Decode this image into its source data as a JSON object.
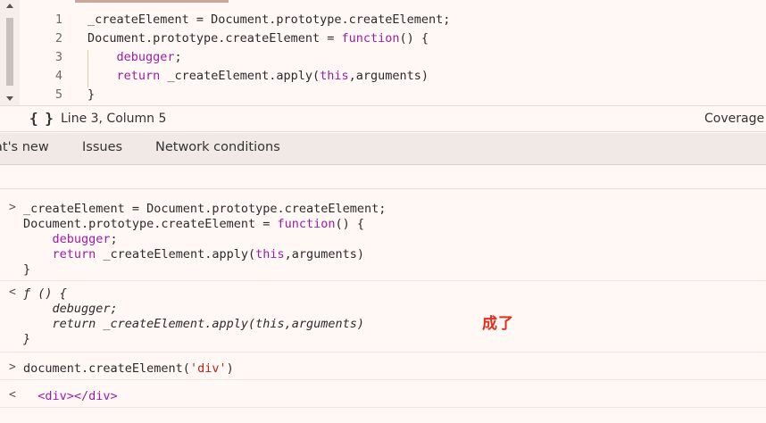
{
  "editor": {
    "lines": [
      {
        "num": "1",
        "parts": [
          {
            "t": "_createElement = Document.prototype.createElement;",
            "c": ""
          }
        ]
      },
      {
        "num": "2",
        "parts": [
          {
            "t": "Document.prototype.createElement = ",
            "c": ""
          },
          {
            "t": "function",
            "c": "kw"
          },
          {
            "t": "() {",
            "c": ""
          }
        ]
      },
      {
        "num": "3",
        "parts": [
          {
            "t": "    ",
            "c": ""
          },
          {
            "t": "debugger",
            "c": "kw"
          },
          {
            "t": ";",
            "c": ""
          }
        ]
      },
      {
        "num": "4",
        "parts": [
          {
            "t": "    ",
            "c": ""
          },
          {
            "t": "return",
            "c": "kw"
          },
          {
            "t": " _createElement.apply(",
            "c": ""
          },
          {
            "t": "this",
            "c": "kw"
          },
          {
            "t": ",arguments)",
            "c": ""
          }
        ]
      },
      {
        "num": "5",
        "parts": [
          {
            "t": "}",
            "c": ""
          }
        ]
      }
    ]
  },
  "status": {
    "braces_icon": "{ }",
    "cursor_position": "Line 3, Column 5",
    "coverage": "Coverage"
  },
  "drawer": {
    "tabs": [
      "at's new",
      "Issues",
      "Network conditions"
    ]
  },
  "console": {
    "input_prompt": ">",
    "output_prompt": "<",
    "entries": [
      {
        "type": "input",
        "lines": [
          [
            {
              "t": "_createElement = Document.prototype.createElement;",
              "c": ""
            }
          ],
          [
            {
              "t": "Document.prototype.createElement = ",
              "c": ""
            },
            {
              "t": "function",
              "c": "kw"
            },
            {
              "t": "() {",
              "c": ""
            }
          ],
          [
            {
              "t": "    ",
              "c": ""
            },
            {
              "t": "debugger",
              "c": "kw"
            },
            {
              "t": ";",
              "c": ""
            }
          ],
          [
            {
              "t": "    ",
              "c": ""
            },
            {
              "t": "return",
              "c": "kw"
            },
            {
              "t": " _createElement.apply(",
              "c": ""
            },
            {
              "t": "this",
              "c": "kw"
            },
            {
              "t": ",arguments)",
              "c": ""
            }
          ],
          [
            {
              "t": "}",
              "c": ""
            }
          ]
        ]
      },
      {
        "type": "output",
        "lines": [
          [
            {
              "t": "ƒ () {",
              "c": "it"
            }
          ],
          [
            {
              "t": "    debugger;",
              "c": "it"
            }
          ],
          [
            {
              "t": "    return _createElement.apply(this,arguments)",
              "c": "it"
            }
          ],
          [
            {
              "t": "}",
              "c": "it"
            }
          ]
        ]
      },
      {
        "type": "input",
        "lines": [
          [
            {
              "t": "document.createElement(",
              "c": ""
            },
            {
              "t": "'div'",
              "c": "str"
            },
            {
              "t": ")",
              "c": ""
            }
          ]
        ]
      },
      {
        "type": "output",
        "lines": [
          [
            {
              "t": "  ",
              "c": ""
            },
            {
              "t": "<div></div>",
              "c": "tag"
            }
          ]
        ]
      }
    ],
    "annotation": "成了"
  },
  "colors": {
    "background": "#fff8f5",
    "keyword": "#9a1ea5",
    "string": "#b3261e",
    "annotation": "#e0301e"
  }
}
